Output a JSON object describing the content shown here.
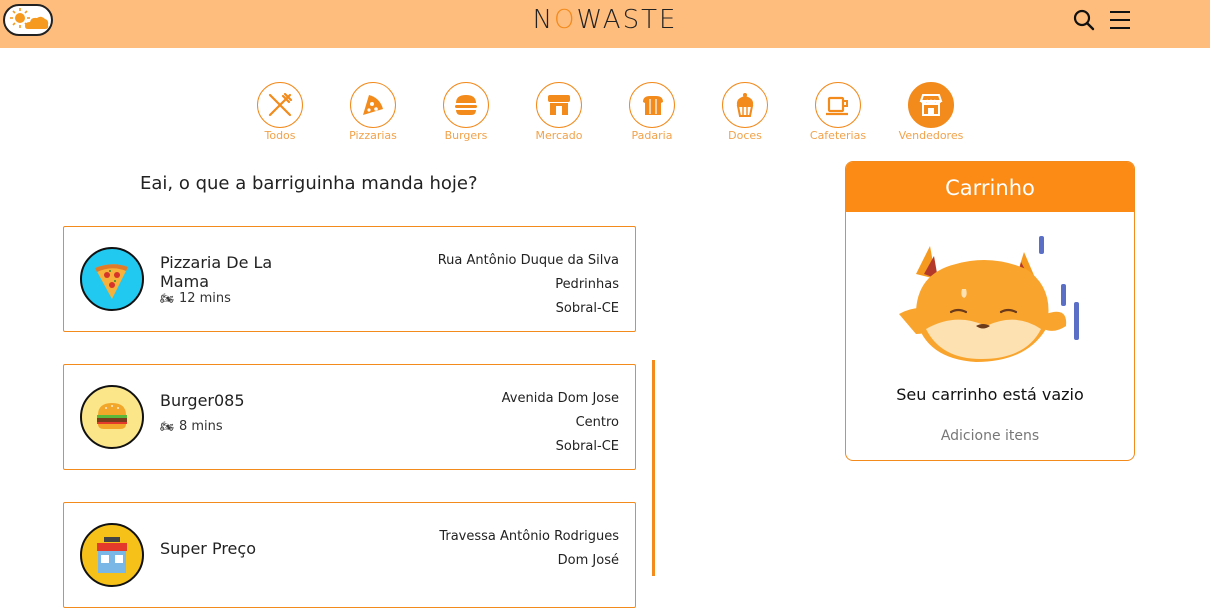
{
  "header": {
    "logo_pre": "N",
    "logo_o": "O",
    "logo_post": "WASTE"
  },
  "categories": [
    {
      "label": "Todos",
      "icon": "fork-knife-icon"
    },
    {
      "label": "Pizzarias",
      "icon": "pizza-icon"
    },
    {
      "label": "Burgers",
      "icon": "burger-icon"
    },
    {
      "label": "Mercado",
      "icon": "market-icon"
    },
    {
      "label": "Padaria",
      "icon": "bread-icon"
    },
    {
      "label": "Doces",
      "icon": "cupcake-icon"
    },
    {
      "label": "Cafeterias",
      "icon": "coffee-icon"
    },
    {
      "label": "Vendedores",
      "icon": "store-icon",
      "active": true
    }
  ],
  "greeting": "Eai, o que a barriguinha manda hoje?",
  "stores": [
    {
      "name": "Pizzaria De La Mama",
      "time": "12 mins",
      "street": "Rua Antônio Duque da Silva",
      "district": "Pedrinhas",
      "city": "Sobral-CE",
      "icon": "pizza-slice-icon"
    },
    {
      "name": "Burger085",
      "time": "8 mins",
      "street": "Avenida Dom Jose",
      "district": "Centro",
      "city": "Sobral-CE",
      "icon": "burger-icon"
    },
    {
      "name": "Super Preço",
      "time": "",
      "street": "Travessa Antônio Rodrigues",
      "district": "Dom José",
      "city": "",
      "icon": "market-icon"
    }
  ],
  "cart": {
    "title": "Carrinho",
    "empty_text": "Seu carrinho está vazio",
    "add_text": "Adicione itens"
  },
  "colors": {
    "header_bg": "#ffbd7d",
    "accent": "#f28a1c",
    "cart_header": "#fb8b14"
  }
}
